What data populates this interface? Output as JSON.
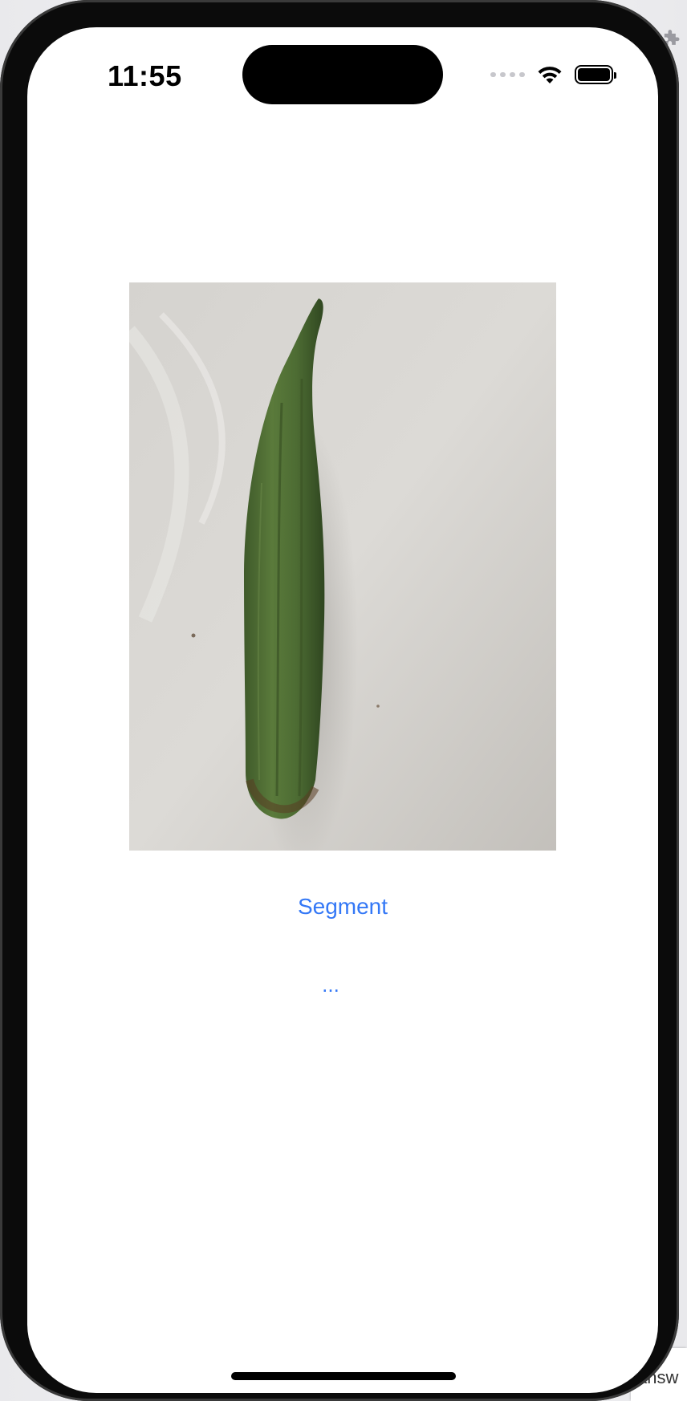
{
  "status_bar": {
    "time": "11:55",
    "icons": [
      "cellular-signal-icon",
      "wifi-icon",
      "battery-icon"
    ]
  },
  "main": {
    "photo_subject": "okra",
    "segment_button_label": "Segment",
    "result_text": "..."
  },
  "background": {
    "partial_text": "answ"
  },
  "colors": {
    "accent": "#3478f6",
    "screen_bg": "#ffffff",
    "frame": "#0b0b0b"
  }
}
